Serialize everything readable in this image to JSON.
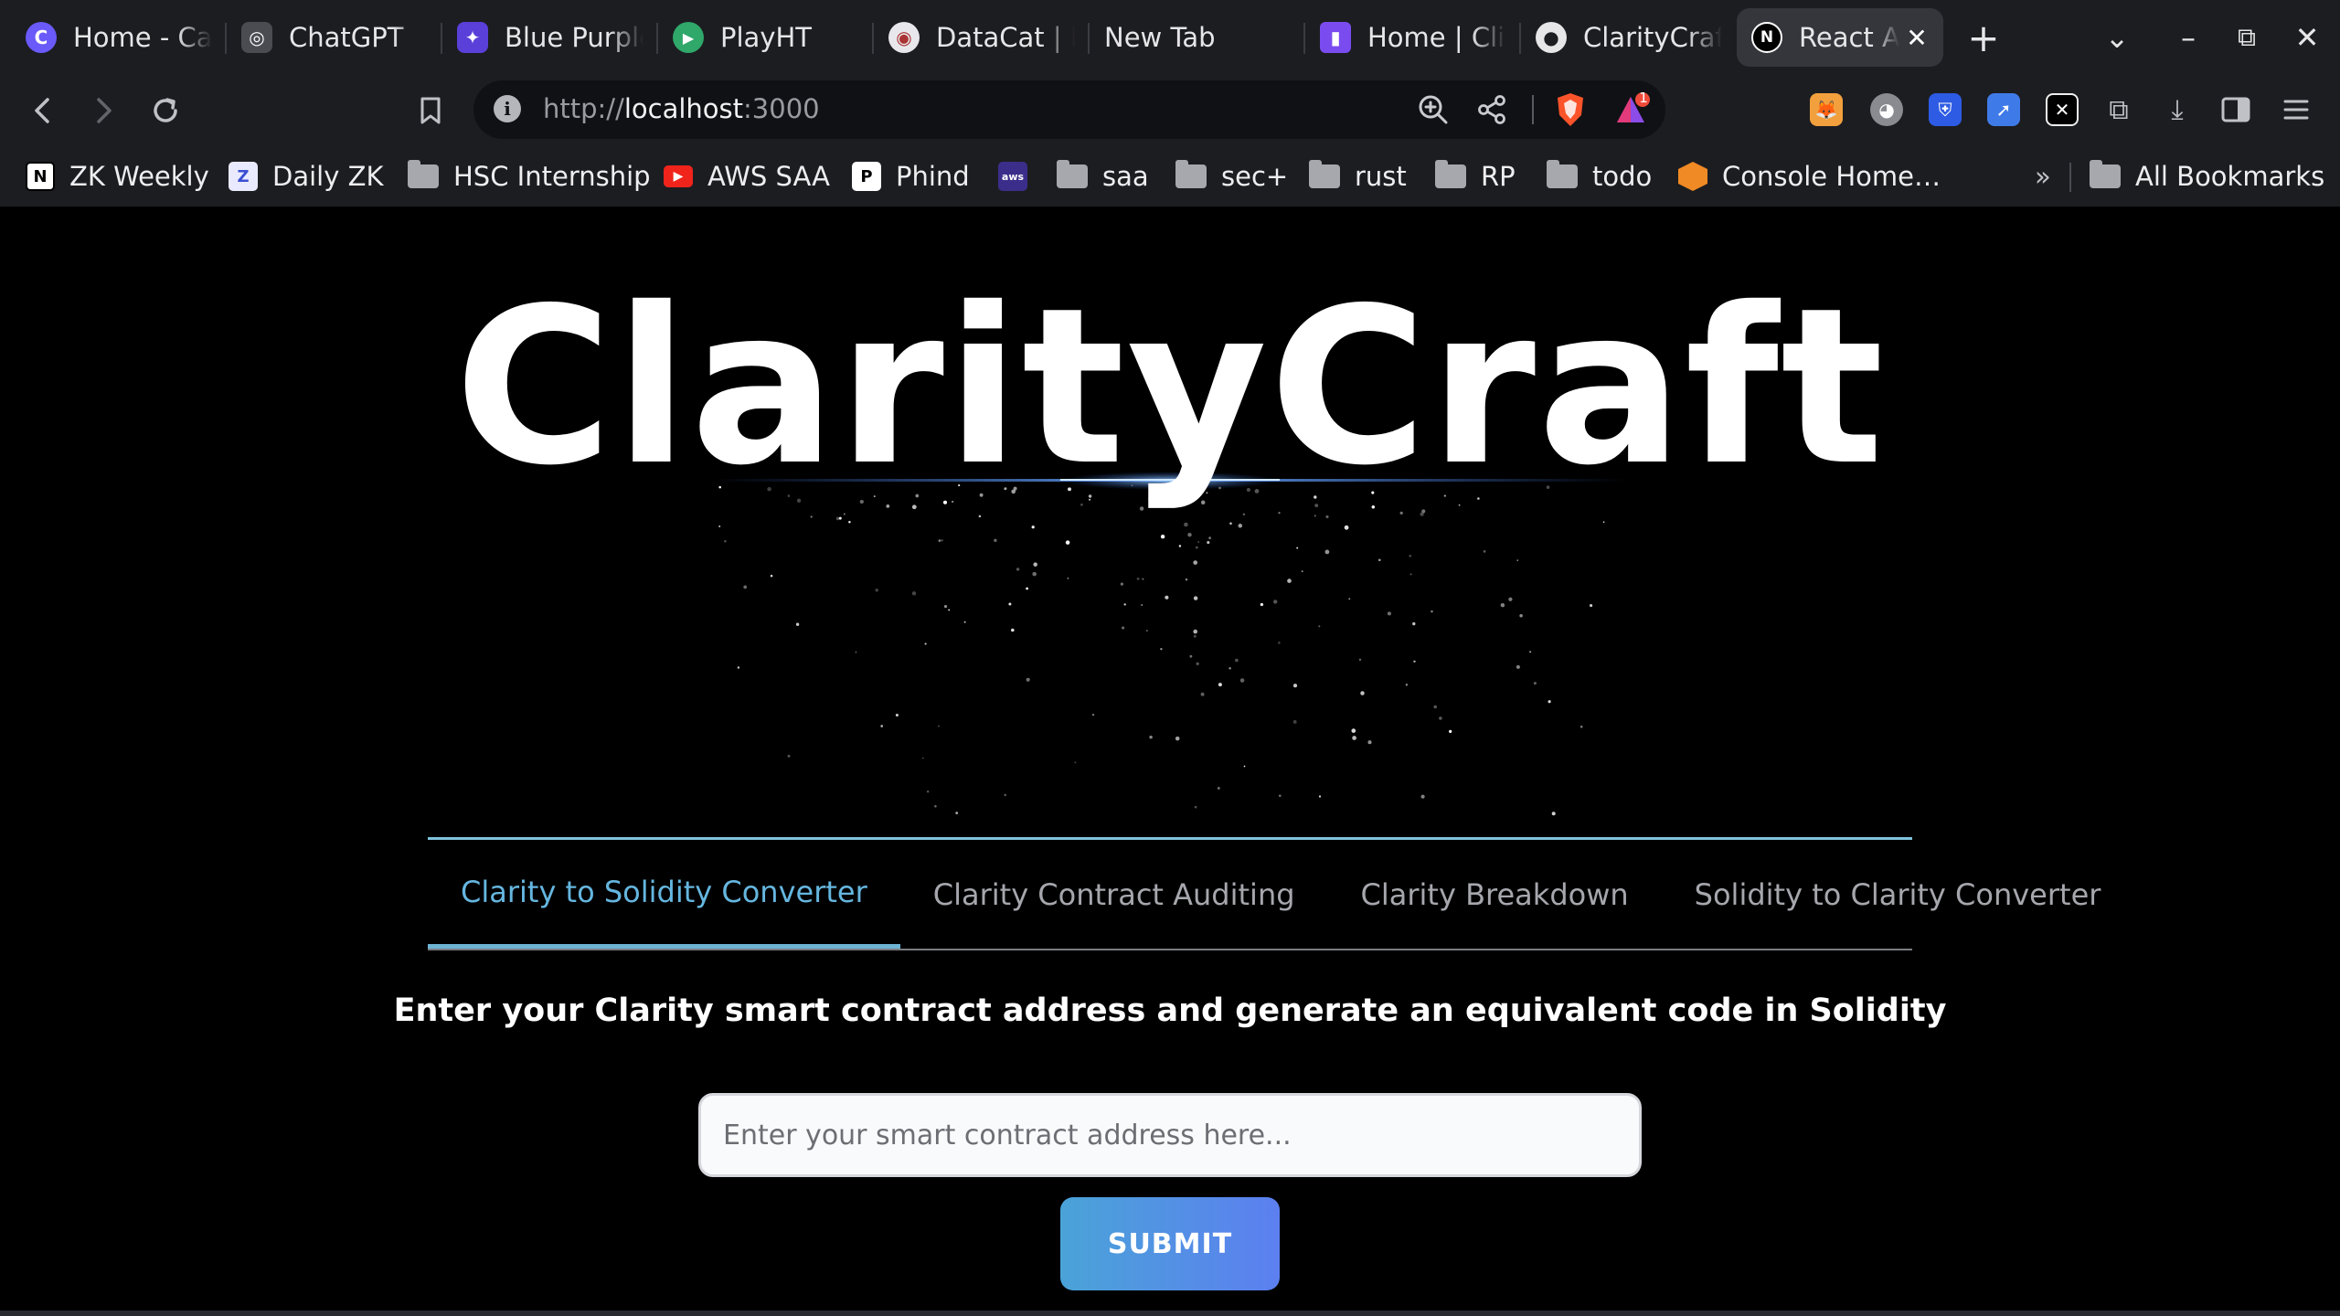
{
  "browser": {
    "tabs": [
      {
        "title": "Home - Canva",
        "fav_color": "#6a5af9",
        "fav_glyph": "C",
        "icon": "canva-icon"
      },
      {
        "title": "ChatGPT",
        "fav_color": "#4b4c52",
        "fav_glyph": "◎",
        "icon": "chatgpt-icon"
      },
      {
        "title": "Blue Purple",
        "fav_color": "#5b3fd9",
        "fav_glyph": "✦",
        "icon": "blue-purple-icon"
      },
      {
        "title": "PlayHT",
        "fav_color": "#2fa86a",
        "fav_glyph": "▶",
        "icon": "playht-icon"
      },
      {
        "title": "DataCat | E",
        "fav_color": "#e8e8ec",
        "fav_glyph": "◉",
        "icon": "datacat-icon"
      },
      {
        "title": "New Tab",
        "fav_color": "",
        "fav_glyph": "",
        "icon": ""
      },
      {
        "title": "Home | Clip",
        "fav_color": "#7a4cf0",
        "fav_glyph": "▮",
        "icon": "clip-icon"
      },
      {
        "title": "ClarityCraft",
        "fav_color": "#e6e6e8",
        "fav_glyph": "●",
        "icon": "github-icon"
      },
      {
        "title": "React App",
        "fav_color": "#000000",
        "fav_glyph": "N",
        "icon": "nextjs-icon"
      }
    ],
    "new_tab_label": "+",
    "address": {
      "scheme": "http://",
      "host": "localhost",
      "port": ":3000"
    },
    "notification_count": "1",
    "bookmarks": [
      {
        "label": "ZK Weekly",
        "icon": "notion-icon"
      },
      {
        "label": "Daily ZK",
        "icon": "zk-icon"
      },
      {
        "label": "HSC Internship",
        "icon": "folder-icon"
      },
      {
        "label": "AWS SAA",
        "icon": "youtube-icon"
      },
      {
        "label": "Phind",
        "icon": "phind-icon"
      },
      {
        "label": "",
        "icon": "aws-icon"
      },
      {
        "label": "saa",
        "icon": "folder-icon"
      },
      {
        "label": "sec+",
        "icon": "folder-icon"
      },
      {
        "label": "rust",
        "icon": "folder-icon"
      },
      {
        "label": "RP",
        "icon": "folder-icon"
      },
      {
        "label": "todo",
        "icon": "folder-icon"
      },
      {
        "label": "Console Home…",
        "icon": "aws-console-icon"
      }
    ],
    "more_bookmarks": "»",
    "all_bookmarks": "All Bookmarks"
  },
  "page": {
    "title": "ClarityCraft",
    "tabs": [
      "Clarity to Solidity Converter",
      "Clarity Contract Auditing",
      "Clarity Breakdown",
      "Solidity to Clarity Converter"
    ],
    "active_tab": 0,
    "instruction": "Enter your Clarity smart contract address and generate an equivalent code in Solidity",
    "input": {
      "value": "",
      "placeholder": "Enter your smart contract address here..."
    },
    "submit_label": "SUBMIT"
  },
  "colors": {
    "accent": "#65b6df",
    "submit_start": "#4aa3d8",
    "submit_end": "#5c7ff0"
  }
}
